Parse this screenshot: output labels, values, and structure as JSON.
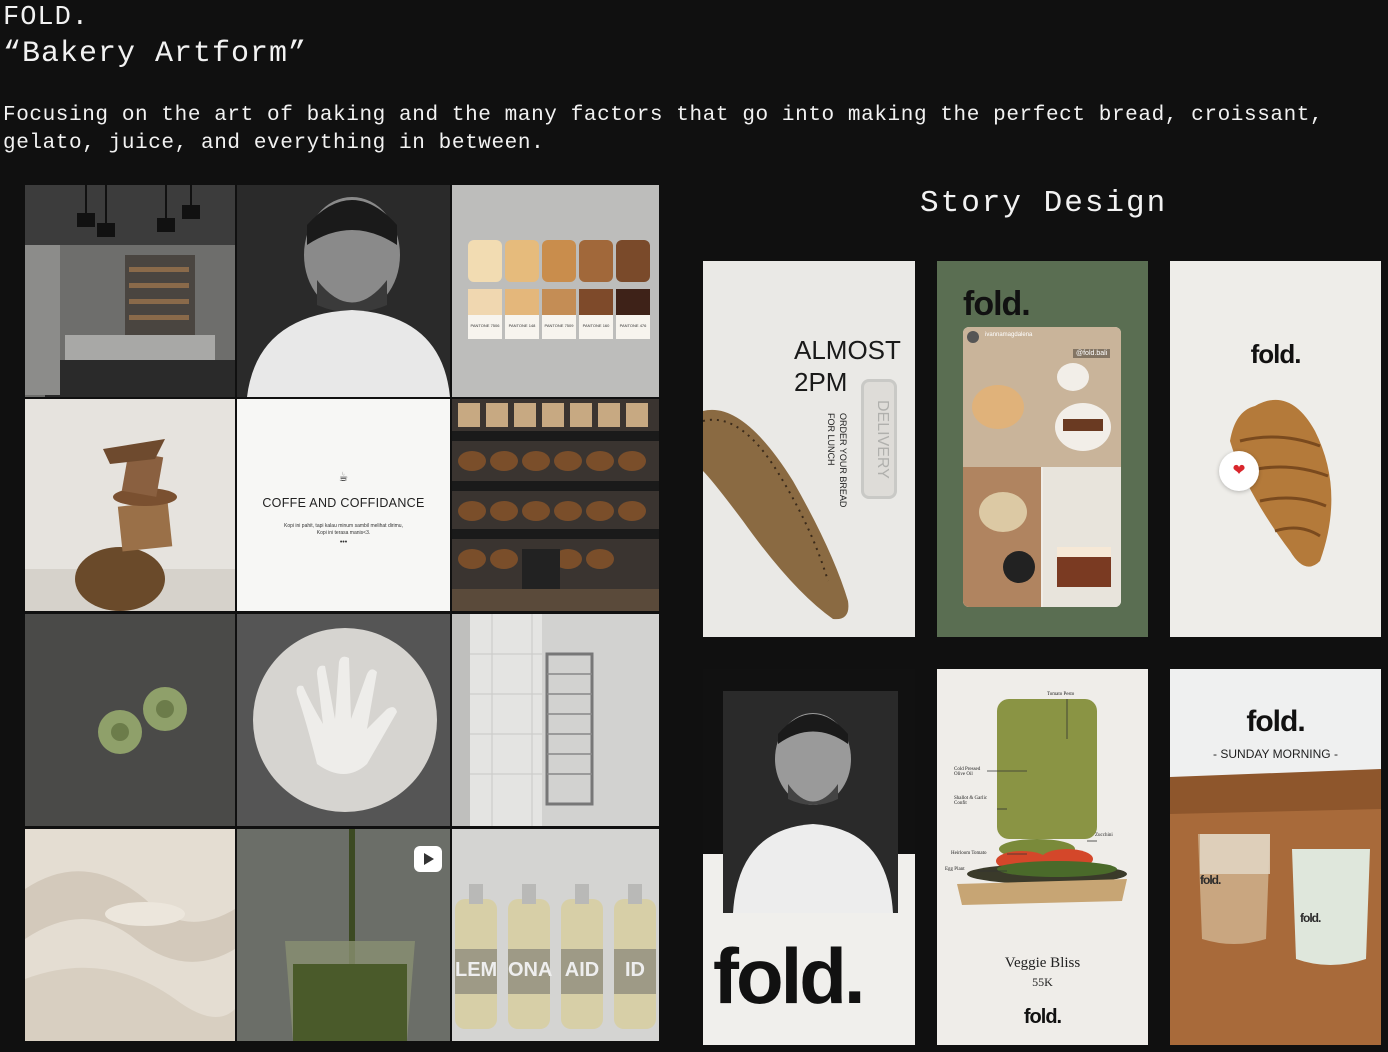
{
  "header": {
    "brand": "FOLD.",
    "tagline": "“Bakery Artform”",
    "description": "Focusing on the art of baking and the many factors that go into making the perfect bread, croissant, gelato, juice, and everything in between."
  },
  "story_section": {
    "title": "Story Design"
  },
  "grid": {
    "pantone_labels": [
      "PANTONE 7506",
      "PANTONE 148",
      "PANTONE 7509",
      "PANTONE 160",
      "PANTONE 476"
    ],
    "coffee_title": "COFFE AND COFFIDANCE",
    "coffee_caption_1": "Kopi ini pahit, tapi kalau minum sambil melihat dirimu,",
    "coffee_caption_2": "Kopi ini terasa manis<3.",
    "coffee_dots": "•••",
    "juice_labels": [
      "LEM",
      "ONA",
      "AID",
      "ID"
    ]
  },
  "stories": {
    "s1_headline_1": "ALMOST",
    "s1_headline_2": "2PM",
    "s1_sub_1": "ORDER YOUR BREAD",
    "s1_sub_2": "FOR LUNCH",
    "s1_sticker": "DELIVERY",
    "s2_logo": "fold.",
    "s2_user": "ivannamagdalena",
    "s2_tag": "@fold.bali",
    "s3_logo": "fold.",
    "s3_heart": "❤",
    "s4_logo": "fold.",
    "s5_labels": [
      "Tomato Pesto",
      "Cold Pressed Olive Oil",
      "Shallot & Garlic Confit",
      "Zucchini",
      "Heirloom Tomato",
      "Egg Plant"
    ],
    "s5_name": "Veggie Bliss",
    "s5_price": "55K",
    "s5_logo": "fold.",
    "s6_logo": "fold.",
    "s6_sub": "- SUNDAY MORNING -",
    "s6_cup1": "fold.",
    "s6_cup2": "fold."
  }
}
